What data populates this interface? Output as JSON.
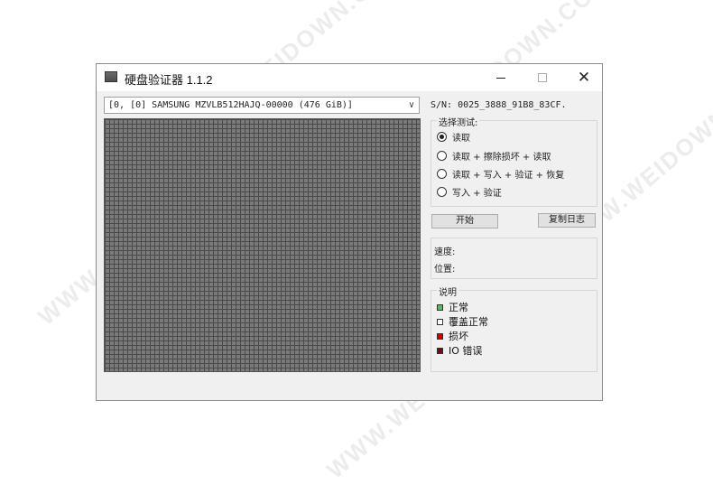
{
  "watermark": [
    "WWW.WEIDOWN.COM",
    "WWW.WEIDOWN.COM",
    "WWW.WEIDOWN.COM",
    "WWW.WEIDOWN.COM",
    "WWW.WEIDOWN.COM"
  ],
  "window": {
    "title": "硬盘验证器 1.1.2"
  },
  "disk": {
    "selected": "[0, [0] SAMSUNG MZVLB512HAJQ-00000 (476 GiB)]"
  },
  "serial": "S/N: 0025_3888_91B8_83CF.",
  "test": {
    "group_label": "选择测试:",
    "options": [
      {
        "label": "读取",
        "checked": true
      },
      {
        "label": "读取 + 擦除损坏 + 读取",
        "checked": false
      },
      {
        "label": "读取 + 写入 + 验证 + 恢复",
        "checked": false
      },
      {
        "label": "写入 + 验证",
        "checked": false
      }
    ]
  },
  "buttons": {
    "start": "开始",
    "copy_log": "复制日志"
  },
  "status": {
    "speed_label": "速度:",
    "position_label": "位置:"
  },
  "legend": {
    "title": "说明",
    "items": [
      {
        "label": "正常",
        "color": "#5cb85c"
      },
      {
        "label": "覆盖正常",
        "color": "#ffffff"
      },
      {
        "label": "损坏",
        "color": "#cc0000"
      },
      {
        "label": "IO 错误",
        "color": "#6b1010"
      }
    ]
  }
}
